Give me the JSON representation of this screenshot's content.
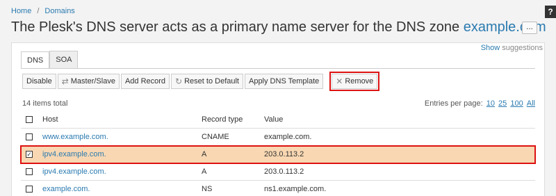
{
  "breadcrumb": {
    "home": "Home",
    "separator": "/",
    "domains": "Domains"
  },
  "help_label": "?",
  "title": {
    "prefix": "The Plesk's DNS server acts as a primary name server for the DNS zone ",
    "domain": "example.com"
  },
  "more_label": "...",
  "suggestions": {
    "show": "Show",
    "rest": " suggestions"
  },
  "tabs": [
    {
      "label": "DNS",
      "active": true
    },
    {
      "label": "SOA",
      "active": false
    }
  ],
  "toolbar": {
    "disable": "Disable",
    "master_slave": "Master/Slave",
    "add_record": "Add Record",
    "reset_default": "Reset to Default",
    "apply_template": "Apply DNS Template",
    "remove": "Remove"
  },
  "items_total": "14 items total",
  "per_page": {
    "label": "Entries per page:",
    "options": [
      "10",
      "25",
      "100",
      "All"
    ]
  },
  "columns": {
    "host": "Host",
    "type": "Record type",
    "value": "Value"
  },
  "rows": [
    {
      "host": "www.example.com.",
      "type": "CNAME",
      "value": "example.com.",
      "checked": false
    },
    {
      "host": "ipv4.example.com.",
      "type": "A",
      "value": "203.0.113.2",
      "checked": true
    },
    {
      "host": "ipv4.example.com.",
      "type": "A",
      "value": "203.0.113.2",
      "checked": false
    },
    {
      "host": "example.com.",
      "type": "NS",
      "value": "ns1.example.com.",
      "checked": false
    }
  ],
  "check_mark": "☑"
}
